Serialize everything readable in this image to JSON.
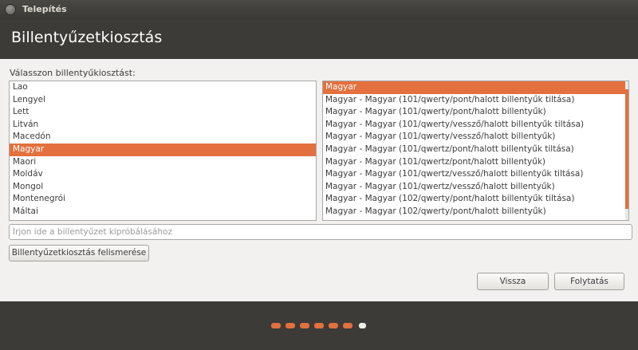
{
  "window": {
    "title": "Telepítés"
  },
  "header": {
    "heading": "Billentyűzetkiosztás"
  },
  "layout_prompt": "Válasszon billentyűkiosztást:",
  "languages": [
    {
      "label": "Lao",
      "selected": false
    },
    {
      "label": "Lengyel",
      "selected": false
    },
    {
      "label": "Lett",
      "selected": false
    },
    {
      "label": "Litván",
      "selected": false
    },
    {
      "label": "Macedón",
      "selected": false
    },
    {
      "label": "Magyar",
      "selected": true
    },
    {
      "label": "Maori",
      "selected": false
    },
    {
      "label": "Moldáv",
      "selected": false
    },
    {
      "label": "Mongol",
      "selected": false
    },
    {
      "label": "Montenegrói",
      "selected": false
    },
    {
      "label": "Máltai",
      "selected": false
    }
  ],
  "variants": [
    {
      "label": "Magyar",
      "selected": true
    },
    {
      "label": "Magyar - Magyar (101/qwerty/pont/halott billentyűk tiltása)",
      "selected": false
    },
    {
      "label": "Magyar - Magyar (101/qwerty/pont/halott billentyűk)",
      "selected": false
    },
    {
      "label": "Magyar - Magyar (101/qwerty/vessző/halott billentyűk tiltása)",
      "selected": false
    },
    {
      "label": "Magyar - Magyar (101/qwerty/vessző/halott billentyűk)",
      "selected": false
    },
    {
      "label": "Magyar - Magyar (101/qwertz/pont/halott billentyűk tiltása)",
      "selected": false
    },
    {
      "label": "Magyar - Magyar (101/qwertz/pont/halott billentyűk)",
      "selected": false
    },
    {
      "label": "Magyar - Magyar (101/qwertz/vessző/halott billentyűk tiltása)",
      "selected": false
    },
    {
      "label": "Magyar - Magyar (101/qwertz/vessző/halott billentyűk)",
      "selected": false
    },
    {
      "label": "Magyar - Magyar (102/qwerty/pont/halott billentyűk tiltása)",
      "selected": false
    },
    {
      "label": "Magyar - Magyar (102/qwerty/pont/halott billentyűk)",
      "selected": false
    }
  ],
  "test_input": {
    "value": "",
    "placeholder": "Írjon ide a billentyűzet kipróbálásához"
  },
  "buttons": {
    "detect": "Billentyűzetkiosztás felismerése",
    "back": "Vissza",
    "next": "Folytatás"
  },
  "progress": {
    "total_steps": 7,
    "current_step": 7
  },
  "colors": {
    "accent": "#e3703e",
    "background_dark": "#3c3b37",
    "content_bg": "#f2f1f0"
  }
}
